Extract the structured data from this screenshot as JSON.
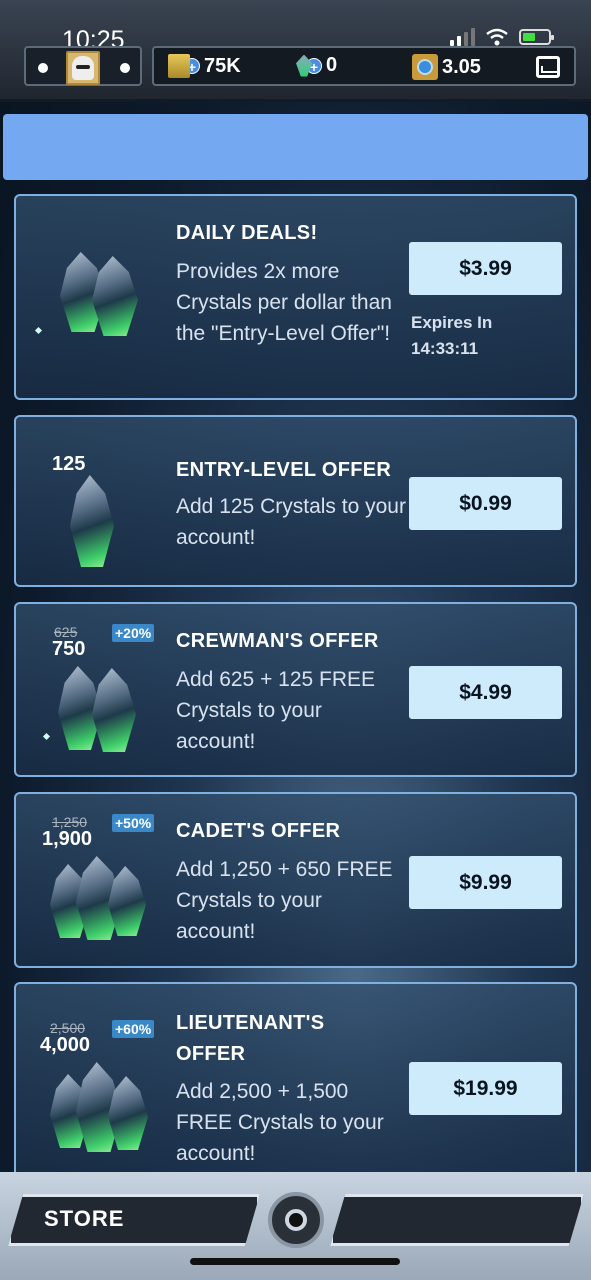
{
  "status_bar": {
    "time": "10:25"
  },
  "currencies": {
    "credits": "75K",
    "crystals": "0",
    "chips": "3.05"
  },
  "offers": [
    {
      "title": "DAILY DEALS!",
      "description": "Provides 2x more Crystals per dollar than the \"Entry-Level Offer\"!",
      "price": "$3.99",
      "expires_label": "Expires In",
      "expires_time": "14:33:11"
    },
    {
      "title": "ENTRY-LEVEL OFFER",
      "description": "Add 125 Crystals to your account!",
      "price": "$0.99",
      "amount": "125"
    },
    {
      "title": "CREWMAN'S OFFER",
      "description": "Add 625 + 125 FREE Crystals to your account!",
      "price": "$4.99",
      "old_amount": "625",
      "amount": "750",
      "bonus": "+20%"
    },
    {
      "title": "CADET'S OFFER",
      "description": "Add 1,250 + 650 FREE Crystals to your account!",
      "price": "$9.99",
      "old_amount": "1,250",
      "amount": "1,900",
      "bonus": "+50%"
    },
    {
      "title": "LIEUTENANT'S OFFER",
      "description": "Add 2,500 + 1,500 FREE Crystals to your account!",
      "price": "$19.99",
      "old_amount": "2,500",
      "amount": "4,000",
      "bonus": "+60%"
    }
  ],
  "bottom_nav": {
    "store_label": "STORE"
  }
}
